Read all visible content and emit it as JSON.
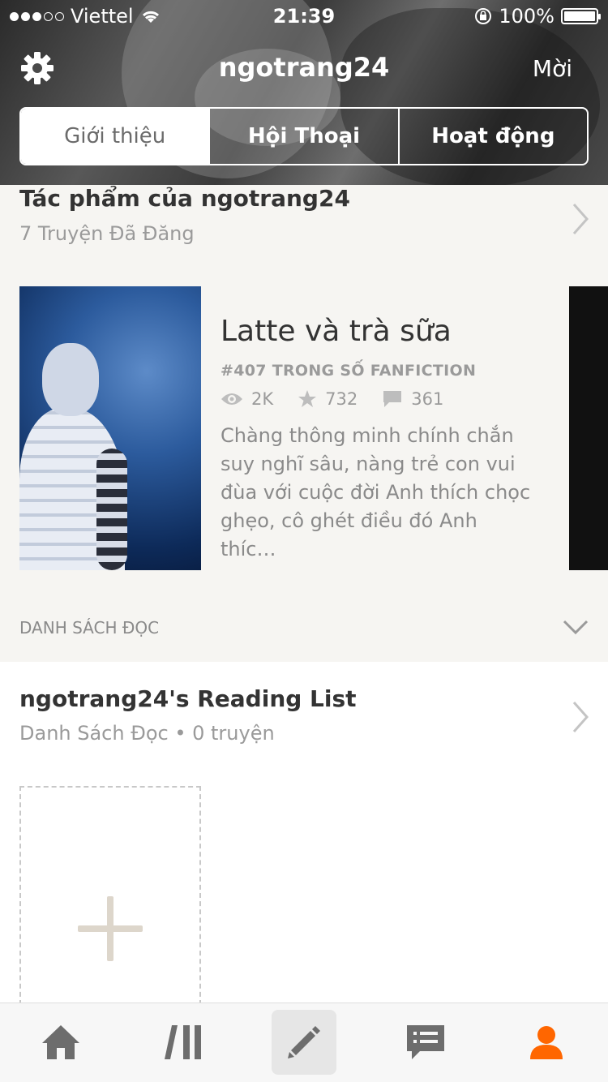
{
  "status_bar": {
    "carrier": "Viettel",
    "time": "21:39",
    "battery": "100%"
  },
  "header": {
    "username": "ngotrang24",
    "invite_label": "Mời",
    "tabs": [
      {
        "label": "Giới thiệu",
        "active": true
      },
      {
        "label": "Hội Thoại",
        "active": false
      },
      {
        "label": "Hoạt động",
        "active": false
      }
    ]
  },
  "works": {
    "title": "Tác phẩm của ngotrang24",
    "subtitle": "7 Truyện Đã Đăng",
    "story": {
      "title": "Latte và trà sữa",
      "rank": "#407 TRONG SỐ FANFICTION",
      "reads": "2K",
      "votes": "732",
      "comments": "361",
      "description": "Chàng thông minh chính chắn suy nghĩ sâu, nàng trẻ con vui đùa với cuộc đời Anh thích chọc ghẹo, cô ghét điều đó Anh thíc…"
    }
  },
  "reading_lists": {
    "section_label": "DANH SÁCH ĐỌC",
    "list_title": "ngotrang24's Reading List",
    "list_subtitle": "Danh Sách Đọc • 0 truyện"
  },
  "bottom_nav": {
    "items": [
      "home-icon",
      "library-icon",
      "write-icon",
      "messages-icon",
      "profile-icon"
    ],
    "active_color": "#ff6600",
    "inactive_color": "#6d6d6d"
  }
}
